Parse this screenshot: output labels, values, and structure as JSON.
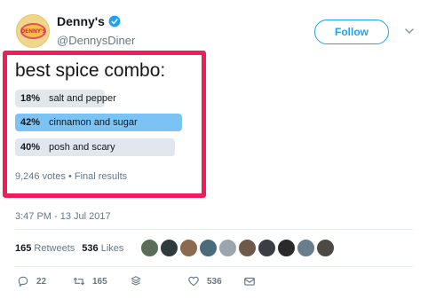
{
  "account": {
    "avatar_text": "DENNY'S",
    "display_name": "Denny's",
    "handle": "@DennysDiner",
    "follow_label": "Follow"
  },
  "poll": {
    "question": "best spice combo:",
    "options": [
      {
        "percent": "18%",
        "label": "salt and pepper",
        "share": 0.18,
        "winner": false
      },
      {
        "percent": "42%",
        "label": "cinnamon and sugar",
        "share": 0.42,
        "winner": true
      },
      {
        "percent": "40%",
        "label": "posh and scary",
        "share": 0.4,
        "winner": false
      }
    ],
    "votes": "9,246 votes",
    "separator": "•",
    "status": "Final results"
  },
  "timestamp": "3:47 PM - 13 Jul 2017",
  "stats": {
    "retweets_count": "165",
    "retweets_label": "Retweets",
    "likes_count": "536",
    "likes_label": "Likes",
    "liker_colors": [
      "#5b6d5a",
      "#2f3a3e",
      "#8b6a4f",
      "#4a6b7a",
      "#9aa5ad",
      "#6d5a4a",
      "#3b3f44",
      "#2a2a2a",
      "#6a7d8c",
      "#4d4a44"
    ]
  },
  "actions": {
    "reply_count": "22",
    "retweet_count": "165",
    "like_count": "536"
  },
  "colors": {
    "brand_blue": "#1da1f2",
    "highlight_frame": "#f01d5b",
    "winner_bar": "#7cc3f5",
    "bar": "#e1e8ed"
  }
}
